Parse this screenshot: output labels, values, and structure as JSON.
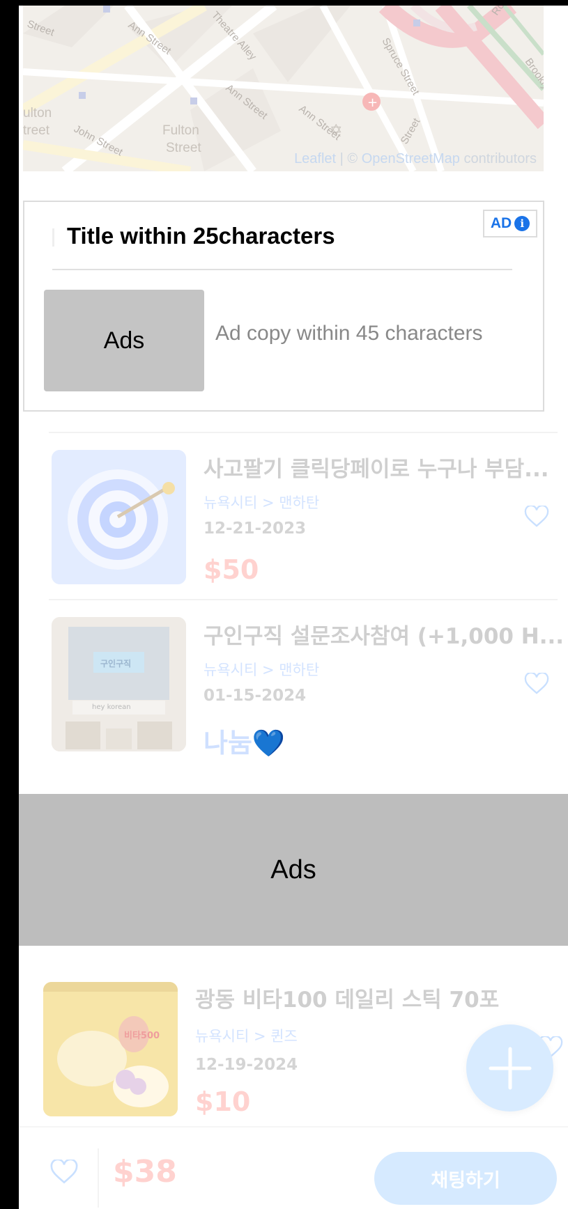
{
  "map": {
    "attribution_leaflet": "Leaflet",
    "attribution_sep": " | © ",
    "attribution_osm": "OpenStreetMap",
    "attribution_tail": " contributors",
    "labels": {
      "ann_street_1": "Ann Street",
      "theatre_alley": "Theatre Alley",
      "ann_street_2": "Ann Street",
      "ann_street_3": "Ann Street",
      "spruce_street": "Spruce Street",
      "fulton_street_1": "Fulton",
      "fulton_street_1b": "Street",
      "fulton_street_left": "ulton",
      "fulton_street_left2": "treet",
      "john_street": "John Street",
      "street_top_left": "Street",
      "rose": "Rose",
      "brooklyn": "Brooklyn",
      "spruce_lower": "Street"
    }
  },
  "native_ad": {
    "title": "Title within 25characters",
    "badge": "AD",
    "image_label": "Ads",
    "copy": "Ad copy within 45 characters"
  },
  "listings": [
    {
      "title": "사고팔기 클릭당페이로 누구나 부담...",
      "location": "뉴욕시티 > 맨하탄",
      "date": "12-21-2023",
      "price": "$50"
    },
    {
      "title": "구인구직 설문조사참여 (+1,000 H...",
      "location": "뉴욕시티 > 맨하탄",
      "date": "01-15-2024",
      "price": "나눔💙",
      "thumb_text_1": "구인구직",
      "thumb_text_2": "hey korean"
    },
    {
      "title": "광동 비타100 데일리 스틱 70포",
      "location": "뉴욕시티 > 퀸즈",
      "date": "12-19-2024",
      "price": "$10",
      "thumb_text_1": "비타500"
    }
  ],
  "banner_ad": {
    "label": "Ads"
  },
  "bottom_bar": {
    "price": "$38",
    "chat_label": "채팅하기"
  },
  "colors": {
    "accent_blue": "#1a73e8",
    "price_red_faded": "#ffd2cf",
    "ad_placeholder_gray": "#bdbdbd"
  },
  "icons": [
    "info-icon",
    "heart-icon",
    "plus-icon",
    "target-icon"
  ]
}
